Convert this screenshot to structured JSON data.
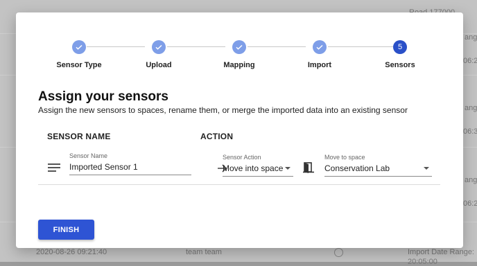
{
  "background": {
    "texts": [
      "Road 177000",
      "ange:",
      "06:2",
      "ange:",
      "06:3",
      "ange:",
      "06:2",
      "2020-08-26 09:21:40",
      "team team",
      "Import Date Range:",
      "20:05:00"
    ]
  },
  "stepper": {
    "steps": [
      {
        "label": "Sensor Type",
        "number": ""
      },
      {
        "label": "Upload",
        "number": ""
      },
      {
        "label": "Mapping",
        "number": ""
      },
      {
        "label": "Import",
        "number": ""
      },
      {
        "label": "Sensors",
        "number": "5"
      }
    ]
  },
  "heading": {
    "title": "Assign your sensors",
    "subtitle": "Assign the new sensors to spaces, rename them, or merge the imported data into an existing sensor"
  },
  "table": {
    "col_sensor_name": "SENSOR NAME",
    "col_action": "ACTION",
    "row": {
      "name_label": "Sensor Name",
      "name_value": "Imported Sensor 1",
      "action_label": "Sensor Action",
      "action_value": "Move into space",
      "space_label": "Move to space",
      "space_value": "Conservation Lab"
    }
  },
  "footer": {
    "finish_label": "FINISH"
  },
  "colors": {
    "accent": "#2e54d4",
    "step_done": "#7e9ee8",
    "step_active": "#2a50c8"
  },
  "icons": [
    "check-icon",
    "menu-icon",
    "arrow-right-icon",
    "door-icon",
    "chevron-down-icon"
  ]
}
